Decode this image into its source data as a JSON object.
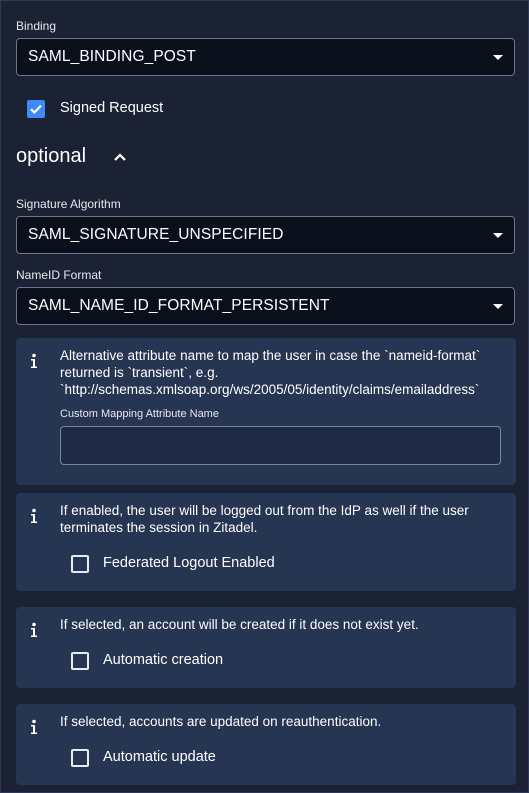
{
  "binding": {
    "label": "Binding",
    "value": "SAML_BINDING_POST"
  },
  "signed_request": {
    "label": "Signed Request",
    "checked": true
  },
  "optional_section": {
    "title": "optional",
    "expanded": true
  },
  "signature_algorithm": {
    "label": "Signature Algorithm",
    "value": "SAML_SIGNATURE_UNSPECIFIED"
  },
  "nameid_format": {
    "label": "NameID Format",
    "value": "SAML_NAME_ID_FORMAT_PERSISTENT"
  },
  "custom_mapping": {
    "info_line1": "Alternative attribute name to map the user in case the `nameid-format`",
    "info_line2": "returned is `transient`, e.g.",
    "info_line3": "`http://schemas.xmlsoap.org/ws/2005/05/identity/claims/emailaddress`",
    "input_label": "Custom Mapping Attribute Name",
    "input_value": ""
  },
  "federated_logout": {
    "info_line1": "If enabled, the user will be logged out from the IdP as well if the user",
    "info_line2": "terminates the session in Zitadel.",
    "label": "Federated Logout Enabled",
    "checked": false
  },
  "automatic_creation": {
    "info": "If selected, an account will be created if it does not exist yet.",
    "label": "Automatic creation",
    "checked": false
  },
  "automatic_update": {
    "info": "If selected, accounts are updated on reauthentication.",
    "label": "Automatic update",
    "checked": false
  },
  "colors": {
    "background": "#1a2233",
    "card": "#263551",
    "accent": "#3d8bf2",
    "field_bg": "#0a0f1c"
  },
  "icons": [
    "caret-down-icon",
    "check-icon",
    "chevron-up-icon",
    "info-icon"
  ]
}
